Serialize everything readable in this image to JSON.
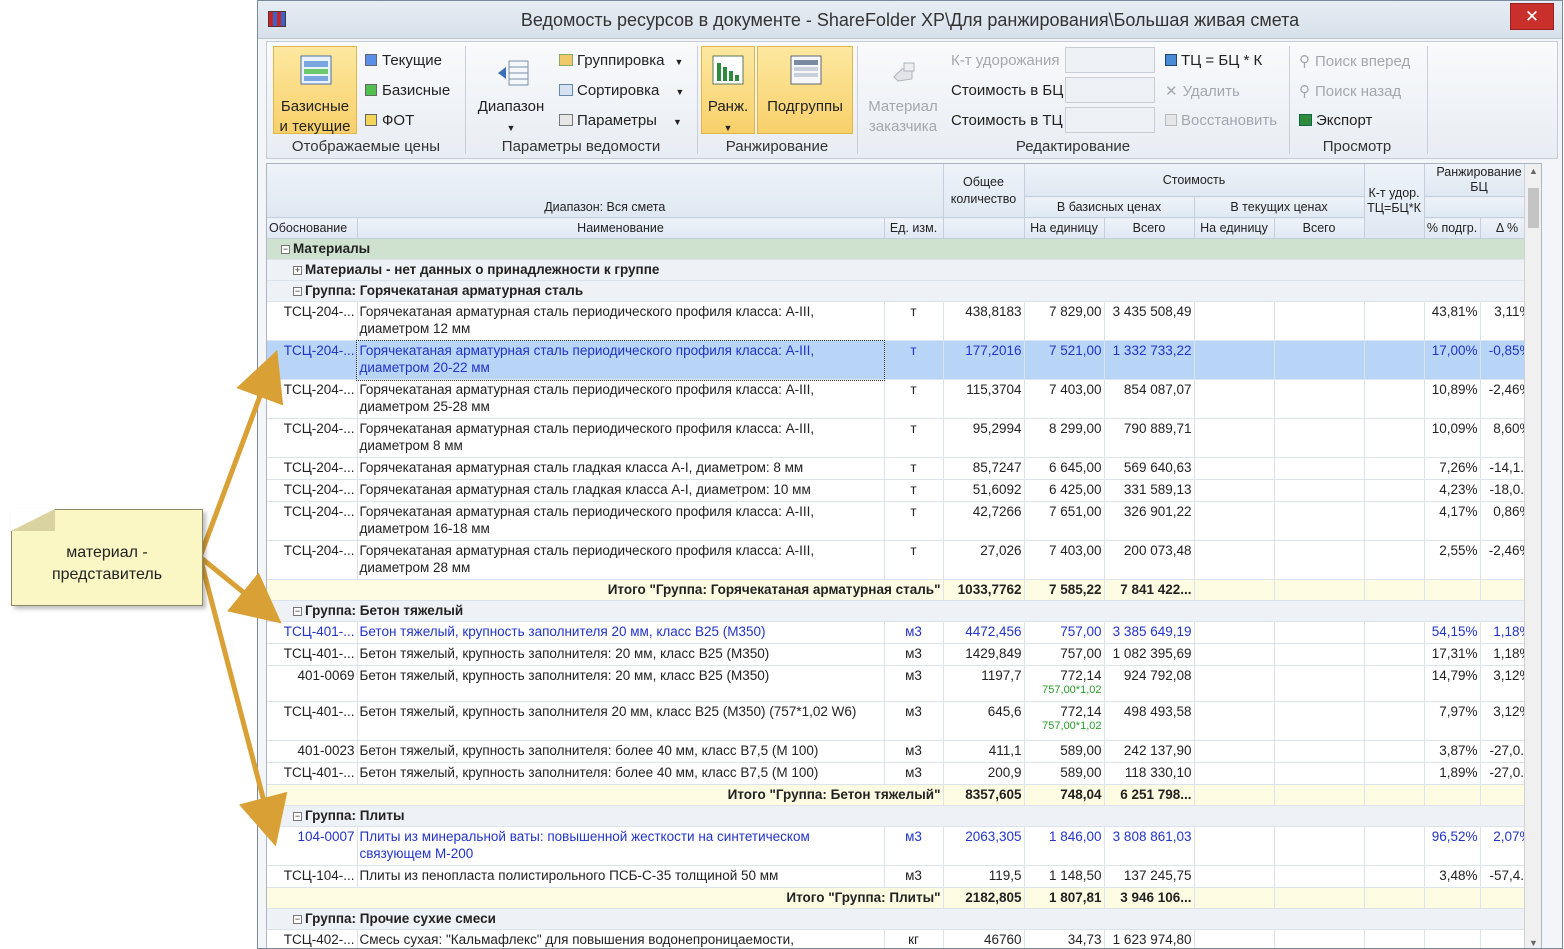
{
  "window": {
    "title": "Ведомость ресурсов в документе - ShareFolder XP\\Для ранжирования\\Большая живая смета",
    "close": "✕"
  },
  "ribbon": {
    "prices": {
      "big_label_1": "Базисные",
      "big_label_2": "и текущие",
      "current": "Текущие",
      "base": "Базисные",
      "fot": "ФОТ",
      "group_label": "Отображаемые цены"
    },
    "params": {
      "range": "Диапазон",
      "grouping": "Группировка",
      "sorting": "Сортировка",
      "parameters": "Параметры",
      "group_label": "Параметры ведомости"
    },
    "ranking": {
      "rank": "Ранж.",
      "subgroups": "Подгруппы",
      "group_label": "Ранжирование"
    },
    "editing": {
      "customer_mat_1": "Материал",
      "customer_mat_2": "заказчика",
      "k_udor": "К-т удорожания",
      "cost_bc": "Стоимость в БЦ",
      "cost_tc": "Стоимость в ТЦ",
      "formula": "ТЦ = БЦ * К",
      "delete": "Удалить",
      "restore": "Восстановить",
      "group_label": "Редактирование"
    },
    "view": {
      "find_next": "Поиск вперед",
      "find_prev": "Поиск назад",
      "export": "Экспорт",
      "group_label": "Просмотр"
    }
  },
  "grid": {
    "header": {
      "range": "Диапазон: Вся смета",
      "basis": "Обоснование",
      "name": "Наименование",
      "unit": "Ед. изм.",
      "qty": "Общее количество",
      "cost": "Стоимость",
      "in_base": "В базисных ценах",
      "in_current": "В текущих ценах",
      "per_unit": "На единицу",
      "total": "Всего",
      "per_unit2": "На единицу",
      "total2": "Всего",
      "k": "К-т удор. ТЦ=БЦ*К",
      "rank": "Ранжирование БЦ",
      "pct": "% подгр.",
      "delta": "Δ %"
    },
    "rows": [
      {
        "type": "sec",
        "toggle": "⊟",
        "text": "Материалы"
      },
      {
        "type": "grp",
        "toggle": "⊞",
        "text": "Материалы - нет данных о принадлежности к группе"
      },
      {
        "type": "grp",
        "toggle": "⊟",
        "text": "Группа: Горячекатаная арматурная сталь"
      },
      {
        "type": "item",
        "h": 39,
        "basis": "ТСЦ-204-...",
        "name": "Горячекатаная арматурная сталь периодического профиля класса: А-III, диаметром 12 мм",
        "unit": "т",
        "qty": "438,8183",
        "pu": "7 829,00",
        "tot": "3 435 508,49",
        "pct": "43,81%",
        "delta": "3,11%"
      },
      {
        "type": "item sel blue",
        "h": 39,
        "basis": "ТСЦ-204-...",
        "name": "Горячекатаная арматурная сталь периодического профиля класса: А-III, диаметром 20-22 мм",
        "unit": "т",
        "qty": "177,2016",
        "pu": "7 521,00",
        "tot": "1 332 733,22",
        "pct": "17,00%",
        "delta": "-0,85%"
      },
      {
        "type": "item",
        "h": 39,
        "basis": "ТСЦ-204-...",
        "name": "Горячекатаная арматурная сталь периодического профиля класса: А-III, диаметром 25-28 мм",
        "unit": "т",
        "qty": "115,3704",
        "pu": "7 403,00",
        "tot": "854 087,07",
        "pct": "10,89%",
        "delta": "-2,46%"
      },
      {
        "type": "item",
        "h": 39,
        "basis": "ТСЦ-204-...",
        "name": "Горячекатаная арматурная сталь периодического профиля класса: А-III, диаметром 8 мм",
        "unit": "т",
        "qty": "95,2994",
        "pu": "8 299,00",
        "tot": "790 889,71",
        "pct": "10,09%",
        "delta": "8,60%"
      },
      {
        "type": "item",
        "h": 22,
        "basis": "ТСЦ-204-...",
        "name": "Горячекатаная арматурная сталь гладкая класса А-I, диаметром: 8 мм",
        "unit": "т",
        "qty": "85,7247",
        "pu": "6 645,00",
        "tot": "569 640,63",
        "pct": "7,26%",
        "delta": "-14,1..."
      },
      {
        "type": "item",
        "h": 22,
        "basis": "ТСЦ-204-...",
        "name": "Горячекатаная арматурная сталь гладкая класса А-I, диаметром: 10 мм",
        "unit": "т",
        "qty": "51,6092",
        "pu": "6 425,00",
        "tot": "331 589,13",
        "pct": "4,23%",
        "delta": "-18,0..."
      },
      {
        "type": "item",
        "h": 39,
        "basis": "ТСЦ-204-...",
        "name": "Горячекатаная арматурная сталь периодического профиля класса: А-III, диаметром 16-18 мм",
        "unit": "т",
        "qty": "42,7266",
        "pu": "7 651,00",
        "tot": "326 901,22",
        "pct": "4,17%",
        "delta": "0,86%"
      },
      {
        "type": "item",
        "h": 39,
        "basis": "ТСЦ-204-...",
        "name": "Горячекатаная арматурная сталь периодического профиля класса: А-III, диаметром 28 мм",
        "unit": "т",
        "qty": "27,026",
        "pu": "7 403,00",
        "tot": "200 073,48",
        "pct": "2,55%",
        "delta": "-2,46%"
      },
      {
        "type": "tot",
        "text": "Итого \"Группа: Горячекатаная арматурная сталь\"",
        "qty": "1033,7762",
        "pu": "7 585,22",
        "tot": "7 841 422..."
      },
      {
        "type": "grp",
        "toggle": "⊟",
        "text": "Группа: Бетон тяжелый"
      },
      {
        "type": "item blue",
        "h": 22,
        "basis": "ТСЦ-401-...",
        "name": "Бетон тяжелый, крупность заполнителя 20 мм, класс В25 (М350)",
        "unit": "м3",
        "qty": "4472,456",
        "pu": "757,00",
        "tot": "3 385 649,19",
        "pct": "54,15%",
        "delta": "1,18%"
      },
      {
        "type": "item",
        "h": 22,
        "basis": "ТСЦ-401-...",
        "name": "Бетон тяжелый, крупность заполнителя: 20 мм, класс В25 (М350)",
        "unit": "м3",
        "qty": "1429,849",
        "pu": "757,00",
        "tot": "1 082 395,69",
        "pct": "17,31%",
        "delta": "1,18%"
      },
      {
        "type": "item",
        "h": 36,
        "basis": "401-0069",
        "name": "Бетон тяжелый, крупность заполнителя: 20 мм, класс В25 (М350)",
        "unit": "м3",
        "qty": "1197,7",
        "pu": "772,14",
        "pusub": "757,00*1,02",
        "tot": "924 792,08",
        "pct": "14,79%",
        "delta": "3,12%"
      },
      {
        "type": "item",
        "h": 39,
        "basis": "ТСЦ-401-...",
        "name": "Бетон тяжелый, крупность заполнителя 20 мм, класс В25 (М350) (757*1,02 W6)",
        "unit": "м3",
        "qty": "645,6",
        "pu": "772,14",
        "pusub": "757,00*1,02",
        "tot": "498 493,58",
        "pct": "7,97%",
        "delta": "3,12%"
      },
      {
        "type": "item",
        "h": 22,
        "basis": "401-0023",
        "name": "Бетон тяжелый, крупность заполнителя: более 40 мм, класс В7,5 (М 100)",
        "unit": "м3",
        "qty": "411,1",
        "pu": "589,00",
        "tot": "242 137,90",
        "pct": "3,87%",
        "delta": "-27,0..."
      },
      {
        "type": "item",
        "h": 22,
        "basis": "ТСЦ-401-...",
        "name": "Бетон тяжелый, крупность заполнителя: более 40 мм, класс В7,5 (М 100)",
        "unit": "м3",
        "qty": "200,9",
        "pu": "589,00",
        "tot": "118 330,10",
        "pct": "1,89%",
        "delta": "-27,0..."
      },
      {
        "type": "tot",
        "text": "Итого \"Группа: Бетон тяжелый\"",
        "qty": "8357,605",
        "pu": "748,04",
        "tot": "6 251 798..."
      },
      {
        "type": "grp",
        "toggle": "⊟",
        "text": "Группа: Плиты"
      },
      {
        "type": "item blue",
        "h": 39,
        "basis": "104-0007",
        "name": "Плиты из минеральной ваты: повышенной жесткости на синтетическом связующем М-200",
        "unit": "м3",
        "qty": "2063,305",
        "pu": "1 846,00",
        "tot": "3 808 861,03",
        "pct": "96,52%",
        "delta": "2,07%"
      },
      {
        "type": "item",
        "h": 22,
        "basis": "ТСЦ-104-...",
        "name": "Плиты из пенопласта полистирольного ПСБ-С-35 толщиной 50 мм",
        "unit": "м3",
        "qty": "119,5",
        "pu": "1 148,50",
        "tot": "137 245,75",
        "pct": "3,48%",
        "delta": "-57,4..."
      },
      {
        "type": "tot",
        "text": "Итого \"Группа: Плиты\"",
        "qty": "2182,805",
        "pu": "1 807,81",
        "tot": "3 946 106..."
      },
      {
        "type": "grp",
        "toggle": "⊟",
        "text": "Группа: Прочие сухие смеси"
      },
      {
        "type": "item",
        "h": 22,
        "basis": "ТСЦ-402-...",
        "name": "Смесь сухая: \"Кальмафлекс\" для повышения водонепроницаемости,",
        "unit": "кг",
        "qty": "46760",
        "pu": "34,73",
        "tot": "1 623 974,80",
        "pct": "",
        "delta": ""
      }
    ]
  },
  "callout": {
    "text_1": "материал -",
    "text_2": "представитель"
  },
  "colors": {
    "accent_orange": "#d9a036",
    "selection": "#b8d5f7",
    "link_blue": "#2233c8",
    "section_green": "#cfe2cf"
  }
}
